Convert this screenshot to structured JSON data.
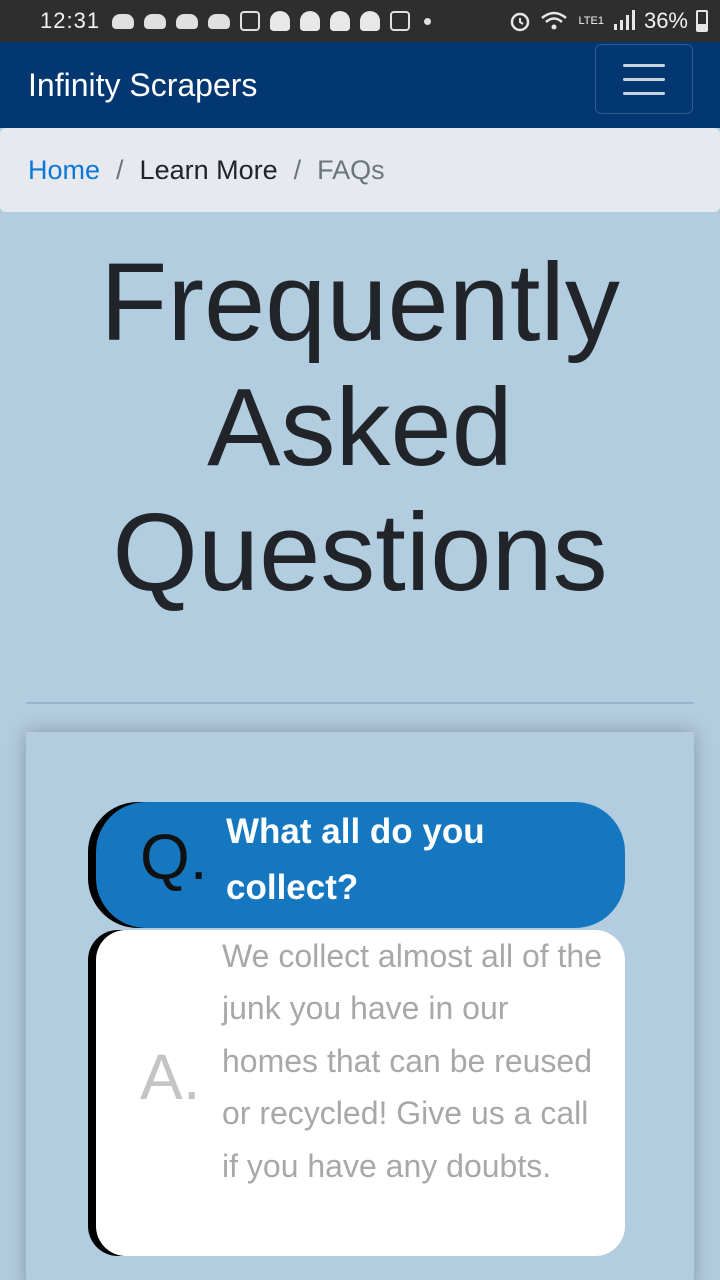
{
  "status_bar": {
    "time": "12:31",
    "battery": "36%",
    "network": "LTE1"
  },
  "navbar": {
    "brand": "Infinity Scrapers",
    "menu_icon": "hamburger-menu-icon"
  },
  "breadcrumb": {
    "items": [
      "Home",
      "Learn More",
      "FAQs"
    ],
    "separator": "/"
  },
  "page": {
    "title_lines": [
      "Frequently",
      "Asked",
      "Questions"
    ]
  },
  "faq": {
    "q_label": "Q.",
    "question": "What all do you collect?",
    "a_label": "A.",
    "answer": "We collect almost all of the junk you have in our homes that can be reused or recycled! Give us a call if you have any doubts."
  },
  "colors": {
    "navbar": "#033771",
    "background": "#b3cde0",
    "question_pill": "#1477bf",
    "link": "#0d77d8"
  }
}
